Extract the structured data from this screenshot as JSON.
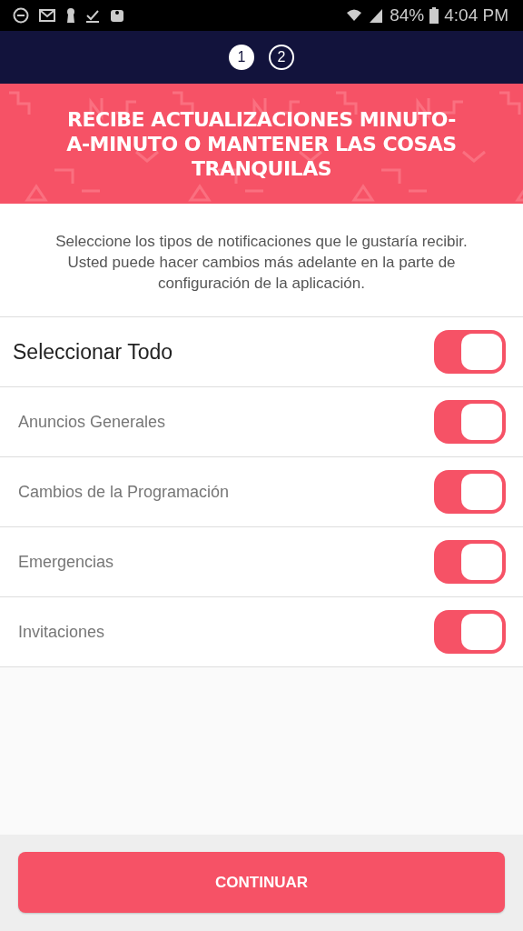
{
  "status_bar": {
    "battery": "84%",
    "time": "4:04 PM"
  },
  "steps": [
    {
      "label": "1",
      "selected": true
    },
    {
      "label": "2",
      "selected": false
    }
  ],
  "banner": {
    "title": "RECIBE ACTUALIZACIONES MINUTO-A-MINUTO O MANTENER LAS COSAS TRANQUILAS"
  },
  "description": "Seleccione los tipos de notificaciones que le gustaría recibir. Usted puede hacer cambios más adelante en la parte de configuración de la aplicación.",
  "options": [
    {
      "label": "Seleccionar Todo",
      "kind": "master",
      "on": true
    },
    {
      "label": "Anuncios Generales",
      "kind": "item",
      "on": true
    },
    {
      "label": "Cambios de la Programación",
      "kind": "item",
      "on": true
    },
    {
      "label": "Emergencias",
      "kind": "item",
      "on": true
    },
    {
      "label": "Invitaciones",
      "kind": "item",
      "on": true
    }
  ],
  "continue_button": "CONTINUAR"
}
